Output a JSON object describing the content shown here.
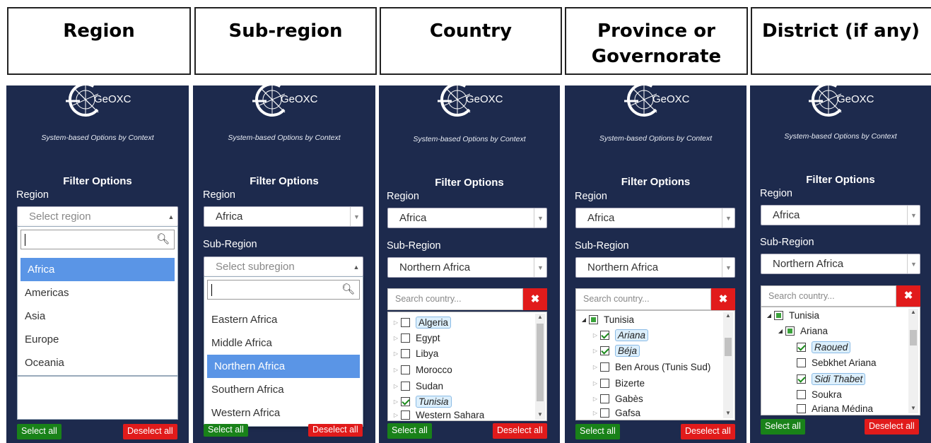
{
  "headers": [
    "Region",
    "Sub-region",
    "Country",
    "Province or\nGovernorate",
    "District (if any)"
  ],
  "logo_text": "GeOXC",
  "tagline": "System-based Options by Context",
  "filter_title": "Filter Options",
  "labels": {
    "region": "Region",
    "subregion": "Sub-Region"
  },
  "buttons": {
    "select_all": "Select all",
    "deselect_all": "Deselect all"
  },
  "panel1": {
    "region_placeholder": "Select region",
    "options": [
      "Africa",
      "Americas",
      "Asia",
      "Europe",
      "Oceania"
    ],
    "highlighted": "Africa"
  },
  "panel2": {
    "region_value": "Africa",
    "subregion_placeholder": "Select subregion",
    "options": [
      "Eastern Africa",
      "Middle Africa",
      "Northern Africa",
      "Southern Africa",
      "Western Africa"
    ],
    "highlighted": "Northern Africa"
  },
  "panel3": {
    "region_value": "Africa",
    "subregion_value": "Northern Africa",
    "search_placeholder": "Search country...",
    "countries": [
      {
        "name": "Algeria",
        "checked": false,
        "boxed": true
      },
      {
        "name": "Egypt",
        "checked": false
      },
      {
        "name": "Libya",
        "checked": false
      },
      {
        "name": "Morocco",
        "checked": false
      },
      {
        "name": "Sudan",
        "checked": false
      },
      {
        "name": "Tunisia",
        "checked": true,
        "boxed": true
      },
      {
        "name": "Western Sahara",
        "checked": false
      }
    ]
  },
  "panel4": {
    "region_value": "Africa",
    "subregion_value": "Northern Africa",
    "search_placeholder": "Search country...",
    "root": "Tunisia",
    "provinces": [
      {
        "name": "Ariana",
        "checked": true
      },
      {
        "name": "Béja",
        "checked": true
      },
      {
        "name": "Ben Arous (Tunis Sud)",
        "checked": false
      },
      {
        "name": "Bizerte",
        "checked": false
      },
      {
        "name": "Gabès",
        "checked": false
      },
      {
        "name": "Gafsa",
        "checked": false
      }
    ]
  },
  "panel5": {
    "region_value": "Africa",
    "subregion_value": "Northern Africa",
    "search_placeholder": "Search country...",
    "root": "Tunisia",
    "province": "Ariana",
    "districts": [
      {
        "name": "Raoued",
        "checked": true
      },
      {
        "name": "Sebkhet Ariana",
        "checked": false
      },
      {
        "name": "Sidi Thabet",
        "checked": true
      },
      {
        "name": "Soukra",
        "checked": false
      },
      {
        "name": "Ariana Médina",
        "checked": false
      }
    ]
  },
  "colors": {
    "panel_bg": "#1d2a4d",
    "highlight": "#5a95e6",
    "green": "#198219",
    "red": "#e11b1b"
  }
}
